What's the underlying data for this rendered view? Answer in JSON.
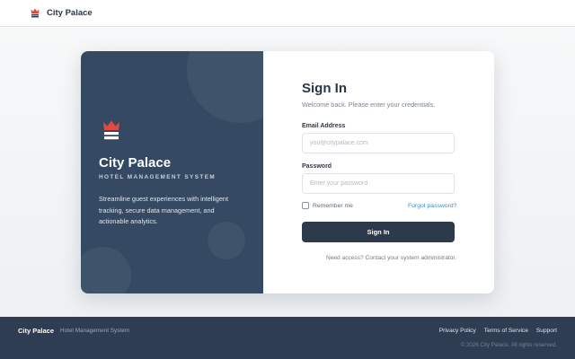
{
  "header": {
    "brand": "City Palace",
    "logo_icon": "crown-icon"
  },
  "login_panel": {
    "title": "City Palace",
    "subtitle": "HOTEL MANAGEMENT SYSTEM",
    "description": "Streamline guest experiences with intelligent tracking, secure data management, and actionable analytics.",
    "logo_icon": "crown-icon"
  },
  "signin": {
    "title": "Sign In",
    "welcome": "Welcome back. Please enter your credentials.",
    "email_label": "Email Address",
    "email_value": "",
    "email_placeholder": "you@citypalace.com",
    "password_label": "Password",
    "password_value": "",
    "password_placeholder": "Enter your password",
    "remember_label": "Remember me",
    "remember_checked": false,
    "forgot_label": "Forgot password?",
    "button_label": "Sign In",
    "access_note": "Need access? Contact your system administrator."
  },
  "footer": {
    "brand": "City Palace",
    "tagline": "Hotel Management System",
    "links": [
      "Privacy Policy",
      "Terms of Service",
      "Support"
    ],
    "copyright": "© 2026 City Palace. All rights reserved."
  },
  "colors": {
    "accent_red": "#e24b3b",
    "panel_dark": "#354a62",
    "button_dark": "#2d3a4c",
    "link_blue": "#3b8bd0",
    "footer_bg": "#2e3d52"
  }
}
